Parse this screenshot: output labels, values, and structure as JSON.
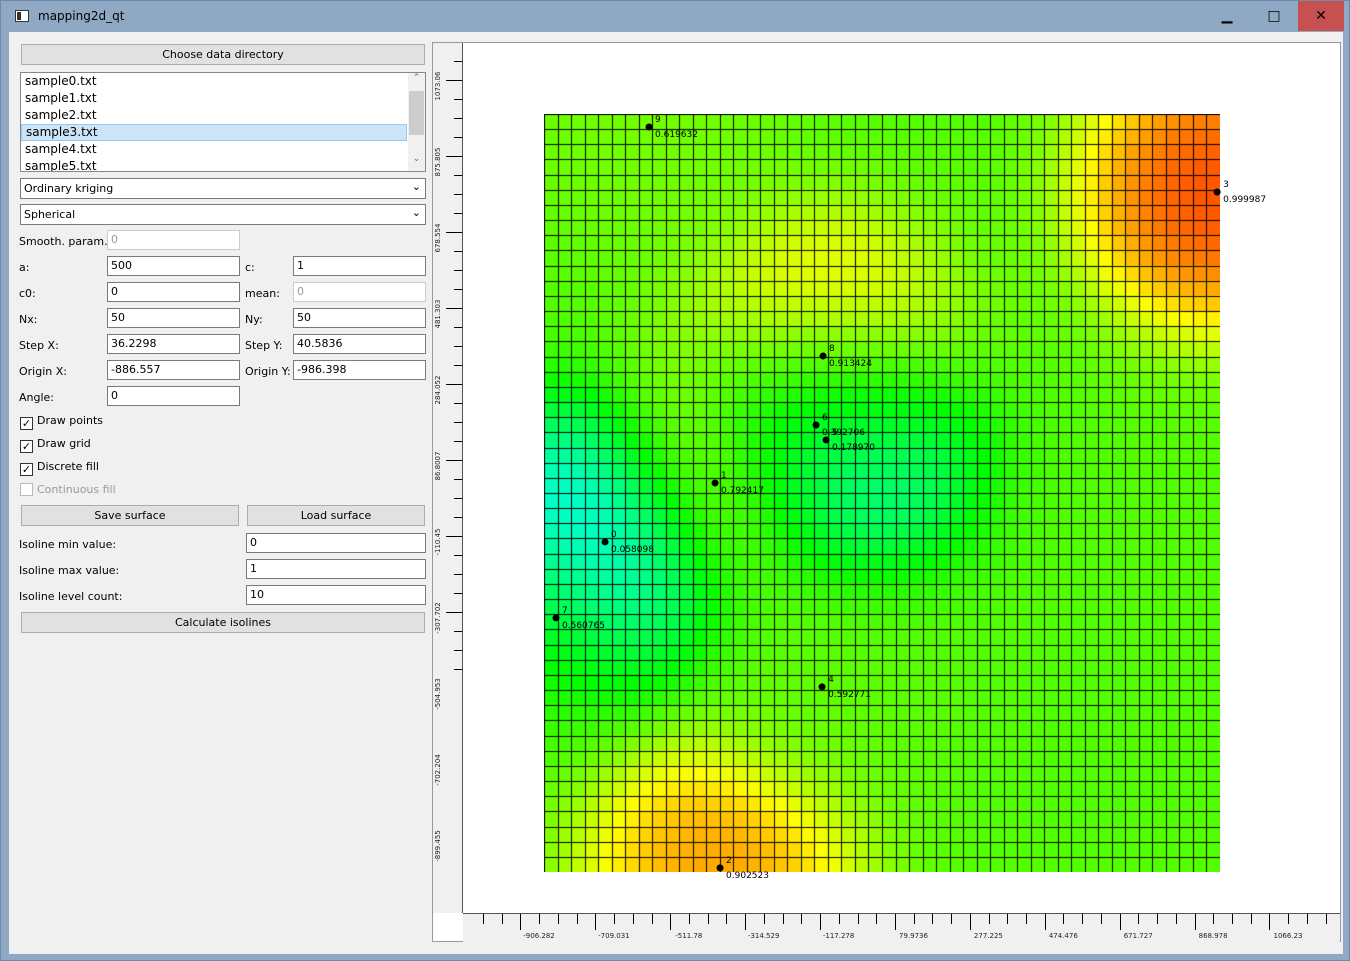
{
  "window": {
    "title": "mapping2d_qt",
    "minimize": "▁",
    "maximize": "□",
    "close": "✕"
  },
  "controls": {
    "choose_dir": "Choose data directory",
    "files": [
      "sample0.txt",
      "sample1.txt",
      "sample2.txt",
      "sample3.txt",
      "sample4.txt",
      "sample5.txt"
    ],
    "selected_file": "sample3.txt",
    "method": "Ordinary kriging",
    "variogram": "Spherical",
    "smooth_label": "Smooth. param.:",
    "smooth": "0",
    "a_label": "a:",
    "a": "500",
    "c_label": "c:",
    "c": "1",
    "c0_label": "c0:",
    "c0": "0",
    "mean_label": "mean:",
    "mean": "0",
    "nx_label": "Nx:",
    "nx": "50",
    "ny_label": "Ny:",
    "ny": "50",
    "stepx_label": "Step X:",
    "stepx": "36.2298",
    "stepy_label": "Step Y:",
    "stepy": "40.5836",
    "originx_label": "Origin X:",
    "originx": "-886.557",
    "originy_label": "Origin Y:",
    "originy": "-986.398",
    "angle_label": "Angle:",
    "angle": "0",
    "draw_points": {
      "label": "Draw points",
      "checked": true
    },
    "draw_grid": {
      "label": "Draw grid",
      "checked": true
    },
    "discrete_fill": {
      "label": "Discrete fill",
      "checked": true
    },
    "continuous_fill": {
      "label": "Continuous fill",
      "checked": false,
      "disabled": true
    },
    "save_surface": "Save surface",
    "load_surface": "Load surface",
    "iso_min_label": "Isoline min value:",
    "iso_min": "0",
    "iso_max_label": "Isoline max value:",
    "iso_max": "1",
    "iso_count_label": "Isoline level count:",
    "iso_count": "10",
    "calc_isolines": "Calculate isolines"
  },
  "chart_data": {
    "type": "heatmap",
    "x_ticks": [
      "-906.282",
      "-709.031",
      "-511.78",
      "-314.529",
      "-117.278",
      "79.9736",
      "277.225",
      "474.476",
      "671.727",
      "868.978",
      "1066.23"
    ],
    "y_ticks": [
      "1073.06",
      "875.805",
      "678.554",
      "481.303",
      "284.052",
      "86.8007",
      "-110.45",
      "-307.702",
      "-504.953",
      "-702.204",
      "-899.455"
    ],
    "colormap": [
      "#0000ff",
      "#00ffff",
      "#00ff00",
      "#ffff00",
      "#ff0000"
    ],
    "value_range": [
      0,
      1
    ],
    "grid": true,
    "points": [
      {
        "id": "0",
        "x": -732.4,
        "y": -105.1,
        "value": "0.058098"
      },
      {
        "id": "1",
        "x": -442.7,
        "y": 48.0,
        "value": "0.792417"
      },
      {
        "id": "2",
        "x": -429.5,
        "y": -951.0,
        "value": "0.902523"
      },
      {
        "id": "3",
        "x": 879.6,
        "y": 803.2,
        "value": "0.999987"
      },
      {
        "id": "4",
        "x": -160.8,
        "y": -481.3,
        "value": "0.592771"
      },
      {
        "id": "5",
        "x": -150.3,
        "y": 159.6,
        "value": "0.178970"
      },
      {
        "id": "6",
        "x": -176.7,
        "y": 198.5,
        "value": "0.392706"
      },
      {
        "id": "7",
        "x": -861.5,
        "y": -302.3,
        "value": "0.560765"
      },
      {
        "id": "8",
        "x": -158.2,
        "y": 377.6,
        "value": "0.913424"
      },
      {
        "id": "9",
        "x": -616.5,
        "y": 971.8,
        "value": "0.619632"
      }
    ]
  }
}
